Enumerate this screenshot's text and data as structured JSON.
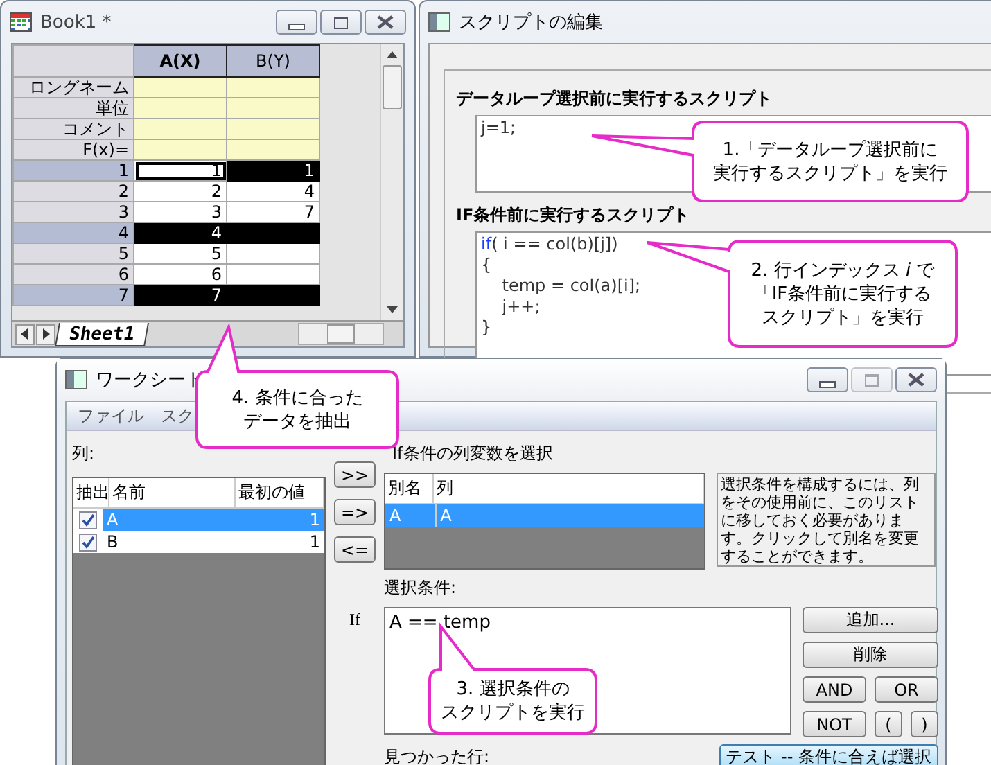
{
  "worksheet_window": {
    "title": "Book1 *",
    "columns": [
      {
        "label": "A(X)",
        "active": true
      },
      {
        "label": "B(Y)",
        "active": false
      }
    ],
    "header_rows": [
      "ロングネーム",
      "単位",
      "コメント",
      "F(x)="
    ],
    "rows": [
      {
        "label": "1",
        "selected": true,
        "cells": [
          {
            "text": "1",
            "active": true
          },
          {
            "text": "1",
            "active": false
          }
        ]
      },
      {
        "label": "2",
        "selected": false,
        "cells": [
          {
            "text": "2",
            "active": false
          },
          {
            "text": "4",
            "active": false
          }
        ]
      },
      {
        "label": "3",
        "selected": false,
        "cells": [
          {
            "text": "3",
            "active": false
          },
          {
            "text": "7",
            "active": false
          }
        ]
      },
      {
        "label": "4",
        "selected": true,
        "cells": [
          {
            "text": "4",
            "active": false
          },
          {
            "active": false
          }
        ]
      },
      {
        "label": "5",
        "selected": false,
        "cells": [
          {
            "text": "5",
            "active": false
          },
          {
            "active": false
          }
        ]
      },
      {
        "label": "6",
        "selected": false,
        "cells": [
          {
            "text": "6",
            "active": false
          },
          {
            "active": false
          }
        ]
      },
      {
        "label": "7",
        "selected": true,
        "cells": [
          {
            "text": "7",
            "active": false
          },
          {
            "active": false
          }
        ]
      }
    ],
    "sheet_tab": "Sheet1"
  },
  "script_window": {
    "title": "スクリプトの編集",
    "before_loop": {
      "label": "データループ選択前に実行するスクリプト",
      "lines": [
        [
          {
            "kind": "plain",
            "text": "j=1;"
          }
        ]
      ]
    },
    "before_if": {
      "label": "IF条件前に実行するスクリプト",
      "lines": [
        [
          {
            "kind": "keyword",
            "text": "if"
          },
          {
            "kind": "plain",
            "text": "( i == col(b)[j])"
          }
        ],
        [
          {
            "kind": "plain",
            "text": "{"
          }
        ],
        [
          {
            "kind": "plain",
            "text": "    temp = col(a)[i];"
          }
        ],
        [
          {
            "kind": "plain",
            "text": "    j++;"
          }
        ],
        [
          {
            "kind": "plain",
            "text": "}"
          }
        ]
      ]
    }
  },
  "dialog": {
    "title": "ワークシート",
    "menu": [
      "ファイル",
      "スク"
    ],
    "columns_label": "列:",
    "columns_list": {
      "headers": [
        "抽出",
        "名前",
        "最初の値"
      ],
      "rows": [
        {
          "checked": true,
          "name": "A",
          "first": "1",
          "selected": true
        },
        {
          "checked": true,
          "name": "B",
          "first": "1",
          "selected": false
        }
      ]
    },
    "move_buttons": [
      ">>",
      "=>",
      "<="
    ],
    "if_label": "If",
    "variables_label": "If条件の列変数を選択",
    "alias_list": {
      "headers": [
        "別名",
        "列"
      ],
      "rows": [
        {
          "alias": "A",
          "column": "A",
          "selected": true
        }
      ]
    },
    "info": "選択条件を構成するには、列をその使用前に、このリストに移しておく必要があります。クリックして別名を変更することができます。",
    "condition_label": "選択条件:",
    "condition": "A == temp",
    "condition_buttons": [
      "追加...",
      "削除",
      "AND",
      "OR",
      "NOT",
      "(",
      ")"
    ],
    "found_label": "見つかった行:",
    "test_button": "テスト -- 条件に合えば選択"
  },
  "callouts": [
    {
      "lines": [
        "1.「データループ選択前に",
        "実行するスクリプト」を実行"
      ]
    },
    {
      "lines": [
        "2. 行インデックス *i* で",
        "「IF条件前に実行する",
        "スクリプト」を実行"
      ]
    },
    {
      "lines": [
        "3. 選択条件の",
        "スクリプトを実行"
      ]
    },
    {
      "lines": [
        "4. 条件に合った",
        "データを抽出"
      ]
    }
  ]
}
